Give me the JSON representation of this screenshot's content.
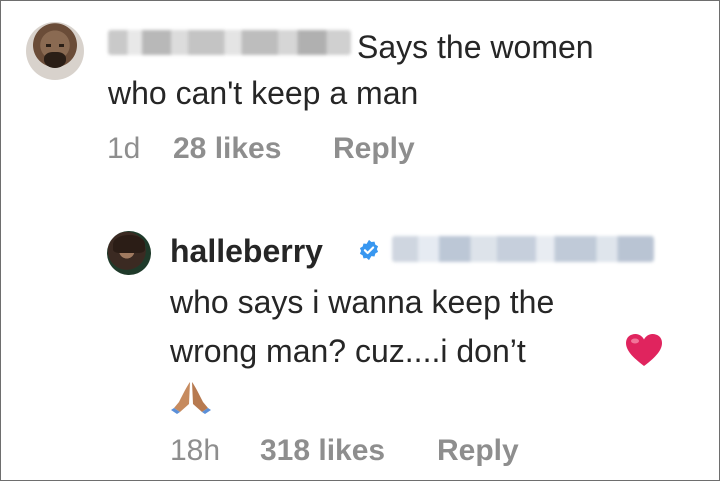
{
  "comment_1": {
    "username_blurred": true,
    "text_line_1": "Says the women",
    "text_line_2": "who can't keep a man",
    "time": "1d",
    "likes": "28 likes",
    "reply_label": "Reply"
  },
  "comment_2": {
    "username": "halleberry",
    "verified": true,
    "mention_blurred": true,
    "text_line_1": "who says i wanna keep the",
    "text_line_2": "wrong man?  cuz....i don’t",
    "emoji_1": "heart-emoji",
    "emoji_2": "folded-hands-emoji",
    "time": "18h",
    "likes": "318 likes",
    "reply_label": "Reply"
  },
  "colors": {
    "text": "#262626",
    "meta": "#8e8e8e",
    "verified_badge": "#3897f0",
    "heart": "#e0245e"
  }
}
